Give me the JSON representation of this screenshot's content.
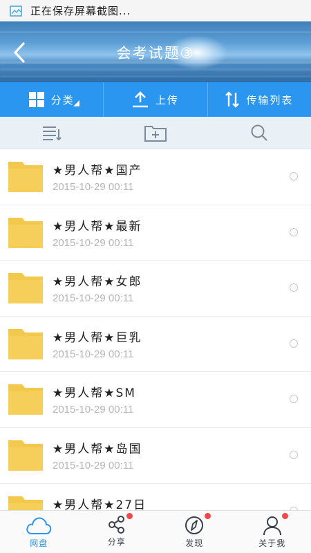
{
  "status_bar": {
    "text": "正在保存屏幕截图..."
  },
  "header": {
    "title": "会考试题③"
  },
  "toolbar": {
    "category_label": "分类",
    "upload_label": "上传",
    "transfer_label": "传输列表"
  },
  "colors": {
    "accent": "#2a96f0",
    "folder": "#f2c94c",
    "badge": "#f04848"
  },
  "files": [
    {
      "name": "★男人帮★国产",
      "date": "2015-10-29 00:11"
    },
    {
      "name": "★男人帮★最新",
      "date": "2015-10-29 00:11"
    },
    {
      "name": "★男人帮★女郎",
      "date": "2015-10-29 00:11"
    },
    {
      "name": "★男人帮★巨乳",
      "date": "2015-10-29 00:11"
    },
    {
      "name": "★男人帮★SM",
      "date": "2015-10-29 00:11"
    },
    {
      "name": "★男人帮★岛国",
      "date": "2015-10-29 00:11"
    },
    {
      "name": "★男人帮★27日",
      "date": ""
    }
  ],
  "bottom_nav": [
    {
      "label": "网盘",
      "icon": "cloud-icon"
    },
    {
      "label": "分享",
      "icon": "share-icon"
    },
    {
      "label": "发现",
      "icon": "compass-icon"
    },
    {
      "label": "关于我",
      "icon": "user-icon"
    }
  ]
}
